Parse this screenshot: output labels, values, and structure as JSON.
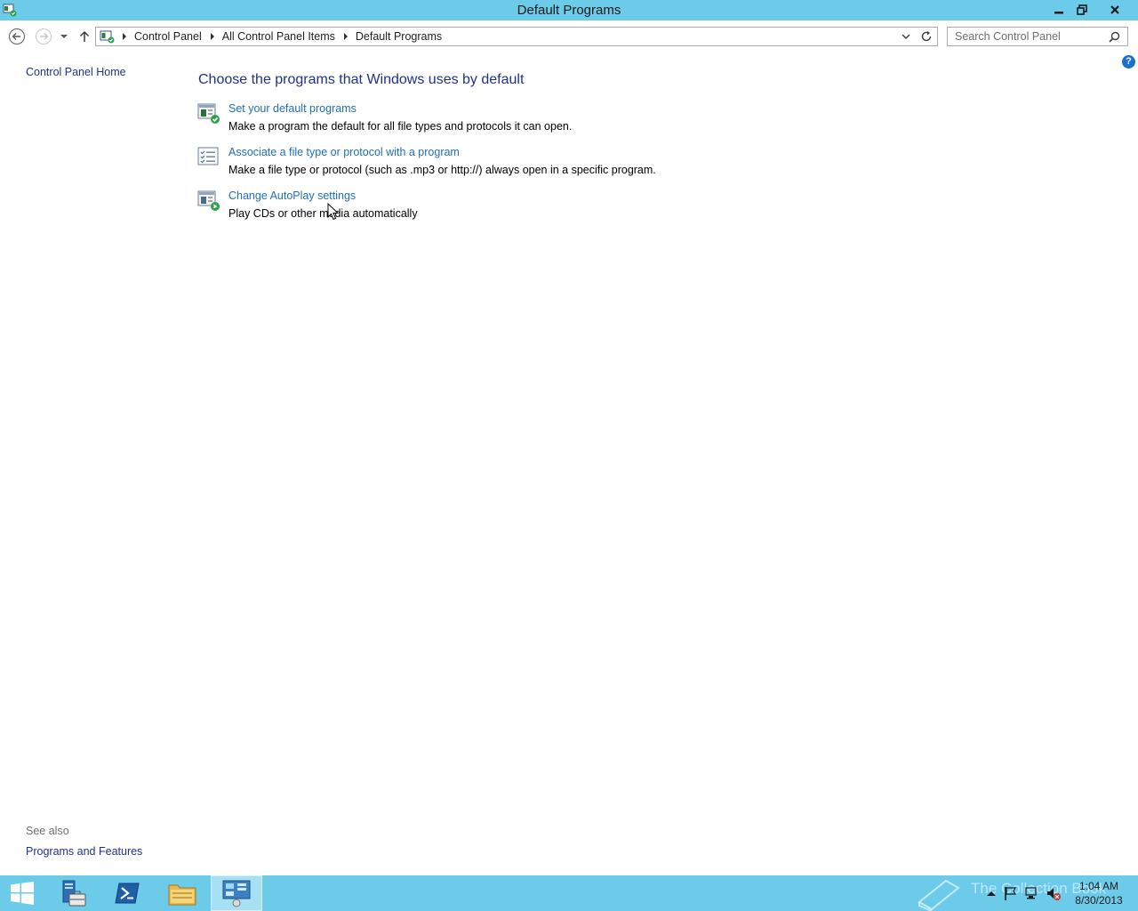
{
  "window": {
    "title": "Default Programs"
  },
  "address": {
    "crumbs": [
      "Control Panel",
      "All Control Panel Items",
      "Default Programs"
    ]
  },
  "search": {
    "placeholder": "Search Control Panel"
  },
  "left_pane": {
    "home_link": "Control Panel Home",
    "see_also_label": "See also",
    "see_also_links": [
      "Programs and Features"
    ]
  },
  "main": {
    "heading": "Choose the programs that Windows uses by default",
    "tasks": [
      {
        "link": "Set your default programs",
        "desc": "Make a program the default for all file types and protocols it can open.",
        "icon": "default-programs-icon"
      },
      {
        "link": "Associate a file type or protocol with a program",
        "desc": "Make a file type or protocol (such as .mp3 or http://) always open in a specific program.",
        "icon": "file-association-icon"
      },
      {
        "link": "Change AutoPlay settings",
        "desc": "Play CDs or other media automatically",
        "icon": "autoplay-icon"
      }
    ]
  },
  "taskbar": {
    "watermark": "The Collection Book",
    "clock_time": "1:04 AM",
    "clock_date": "8/30/2013"
  },
  "colors": {
    "titlebar": "#6ccbe8",
    "link": "#1e3287",
    "task_link": "#1e6fb3"
  }
}
